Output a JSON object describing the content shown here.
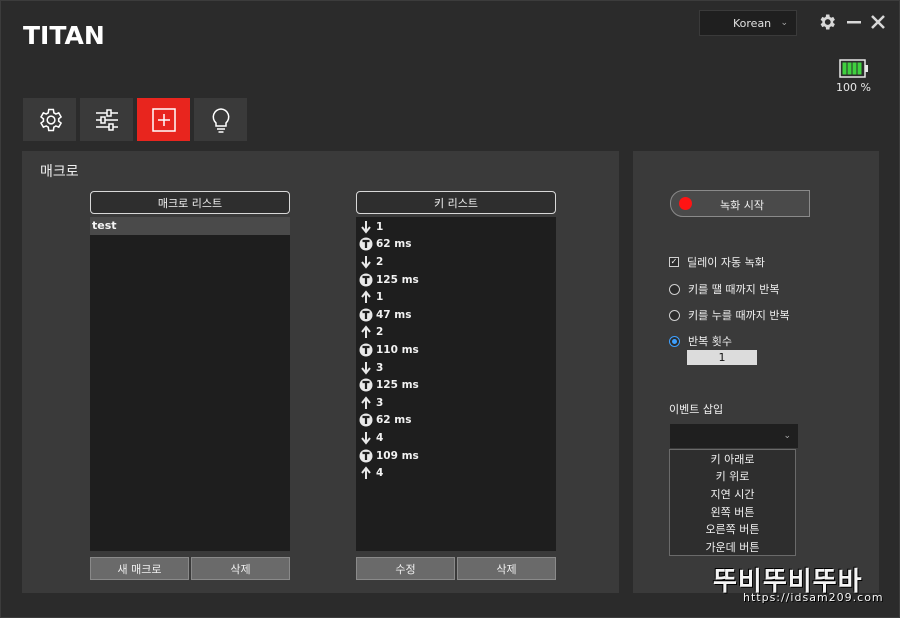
{
  "app": {
    "logo": "TITAN"
  },
  "header": {
    "language": "Korean",
    "battery_text": "100 %",
    "battery_level": 1.0,
    "battery_color": "#3fd13f"
  },
  "tabs": [
    {
      "icon": "gear-icon"
    },
    {
      "icon": "sliders-icon"
    },
    {
      "icon": "macro-add-icon",
      "active": true
    },
    {
      "icon": "lightbulb-icon"
    }
  ],
  "accent_color": "#e8251e",
  "macro": {
    "title": "매크로",
    "macro_list_header": "매크로 리스트",
    "macros": [
      "test"
    ],
    "new_macro_label": "새 매크로",
    "delete_label": "삭제"
  },
  "keys": {
    "header": "키 리스트",
    "items": [
      {
        "icon": "arrow-down-icon",
        "text": "1"
      },
      {
        "icon": "timer-icon",
        "text": "62 ms"
      },
      {
        "icon": "arrow-down-icon",
        "text": "2"
      },
      {
        "icon": "timer-icon",
        "text": "125 ms"
      },
      {
        "icon": "arrow-up-icon",
        "text": "1"
      },
      {
        "icon": "timer-icon",
        "text": "47 ms"
      },
      {
        "icon": "arrow-up-icon",
        "text": "2"
      },
      {
        "icon": "timer-icon",
        "text": "110 ms"
      },
      {
        "icon": "arrow-down-icon",
        "text": "3"
      },
      {
        "icon": "timer-icon",
        "text": "125 ms"
      },
      {
        "icon": "arrow-up-icon",
        "text": "3"
      },
      {
        "icon": "timer-icon",
        "text": "62 ms"
      },
      {
        "icon": "arrow-down-icon",
        "text": "4"
      },
      {
        "icon": "timer-icon",
        "text": "109 ms"
      },
      {
        "icon": "arrow-up-icon",
        "text": "4"
      }
    ],
    "edit_label": "수정",
    "delete_label": "삭제"
  },
  "record": {
    "start_label": "녹화 시작",
    "delay_auto_record": "딜레이 자동 녹화",
    "delay_checked": true,
    "repeat_until_release": "키를 땔 때까지 반복",
    "repeat_until_press": "키를 누를 때까지 반복",
    "repeat_count_label": "반복 횟수",
    "repeat_count_value": "1",
    "selected_repeat_mode": "repeat_count"
  },
  "events": {
    "label": "이벤트 삽입",
    "options": [
      "키 아래로",
      "키 위로",
      "지연 시간",
      "왼쪽 버튼",
      "오른쪽 버튼",
      "가운데 버튼"
    ]
  },
  "watermark": {
    "main": "뚜비뚜비뚜바",
    "url": "https://idsam209.com"
  }
}
